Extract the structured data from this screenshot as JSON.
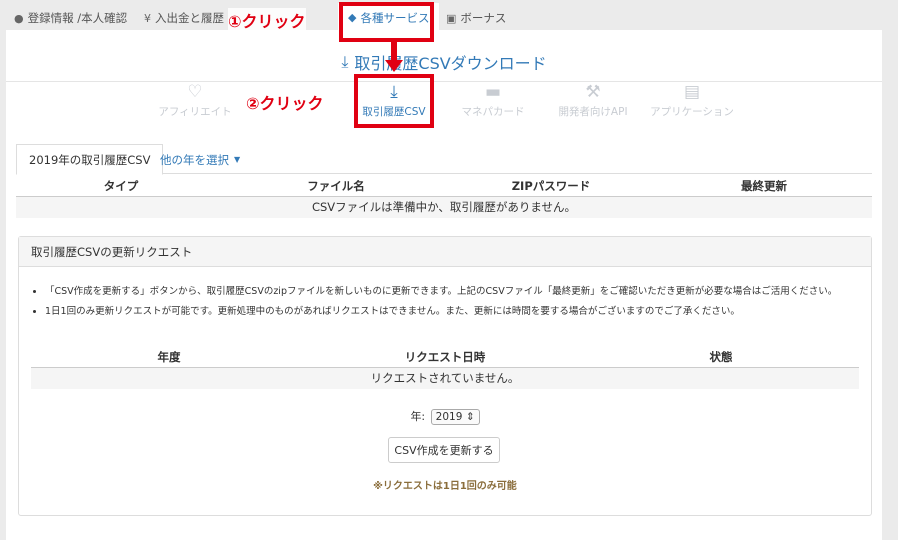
{
  "topnav": [
    {
      "label": "登録情報 /本人確認",
      "icon": "user-icon"
    },
    {
      "label": "入出金と履歴",
      "icon": "yen-icon"
    },
    {
      "label": "各種サービス",
      "icon": "tag-icon"
    },
    {
      "label": "ボーナス",
      "icon": "gift-icon"
    }
  ],
  "annotations": {
    "step1": "①クリック",
    "step2": "②クリック"
  },
  "page_title": "取引履歴CSVダウンロード",
  "services": [
    {
      "label": "アフィリエイト",
      "icon": "heart-icon"
    },
    {
      "label": "取引履歴CSV",
      "icon": "download-icon"
    },
    {
      "label": "マネパカード",
      "icon": "card-icon"
    },
    {
      "label": "開発者向けAPI",
      "icon": "wrench-icon"
    },
    {
      "label": "アプリケーション",
      "icon": "briefcase-icon"
    }
  ],
  "year_tabs": {
    "active": "2019年の取引履歴CSV",
    "other": "他の年を選択"
  },
  "csv_table": {
    "headers": [
      "タイプ",
      "ファイル名",
      "ZIPパスワード",
      "最終更新"
    ],
    "empty_message": "CSVファイルは準備中か、取引履歴がありません。"
  },
  "request_panel": {
    "title": "取引履歴CSVの更新リクエスト",
    "bullets": [
      "「CSV作成を更新する」ボタンから、取引履歴CSVのzipファイルを新しいものに更新できます。上記のCSVファイル「最終更新」をご確認いただき更新が必要な場合はご活用ください。",
      "1日1回のみ更新リクエストが可能です。更新処理中のものがあればリクエストはできません。また、更新には時間を要する場合がございますのでご了承ください。"
    ],
    "table_headers": [
      "年度",
      "リクエスト日時",
      "状態"
    ],
    "empty_message": "リクエストされていません。",
    "year_label": "年:",
    "year_value": "2019",
    "button_label": "CSV作成を更新する",
    "note": "※リクエストは1日1回のみ可能"
  },
  "colors": {
    "accent": "#337ab7",
    "annotation": "#e00012",
    "note": "#8a6d3b"
  }
}
